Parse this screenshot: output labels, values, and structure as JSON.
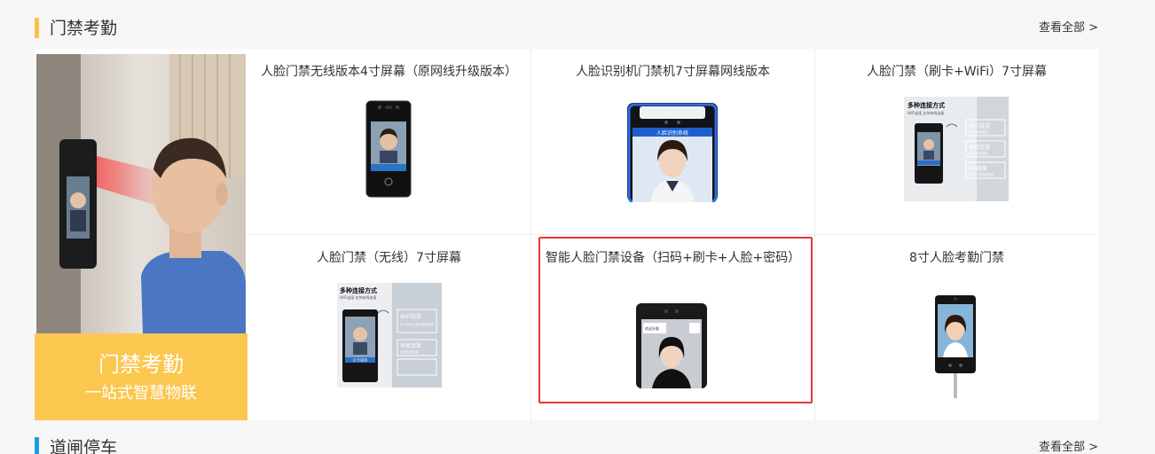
{
  "section1": {
    "title": "门禁考勤",
    "more": "查看全部 >",
    "banner": {
      "line1": "门禁考勤",
      "line2": "一站式智慧物联"
    },
    "products": [
      {
        "name": "人脸门禁无线版本4寸屏幕（原网线升级版本）"
      },
      {
        "name": "人脸识别机门禁机7寸屏幕网线版本",
        "screen_title": "人脸识别系统"
      },
      {
        "name": "人脸门禁（刷卡+WiFi）7寸屏幕",
        "promo": {
          "title": "多种连接方式",
          "sub": "WiFi连接 支持有线连接",
          "opt1": "WiFi连接",
          "opt1_sub": "支持有线连接",
          "opt2": "有线连接",
          "opt2_sub": "支持有线连接",
          "opt3": "4G网络",
          "opt3_sub": "适用于无网络场景"
        }
      },
      {
        "name": "人脸门禁（无线）7寸屏幕",
        "promo": {
          "title": "多种连接方式",
          "sub": "WiFi连接 支持有线连接",
          "opt1": "WiFi连接",
          "opt1_sub": "(2.4GHz) 支持连接无线",
          "opt2": "有线连接",
          "opt2_sub": "支持有线连接",
          "opt3": "",
          "opt3_sub": ""
        },
        "screen_label": "打卡成功"
      },
      {
        "name": "智能人脸门禁设备（扫码+刷卡+人脸+密码）",
        "screen_label": "欢迎光临"
      },
      {
        "name": "8寸人脸考勤门禁"
      }
    ]
  },
  "section2": {
    "title": "道闸停车",
    "more": "查看全部 >"
  },
  "colors": {
    "accent_yellow": "#f7c24a",
    "accent_blue": "#1e9be0",
    "highlight_red": "#e03a3a"
  }
}
